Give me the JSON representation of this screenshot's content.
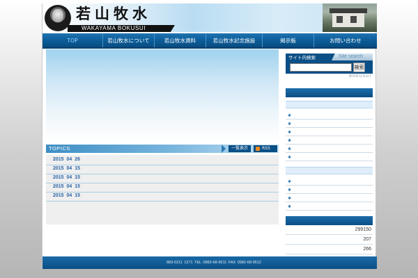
{
  "header": {
    "logo_kanji": "若山牧水",
    "logo_roman": "WAKAYAMA BOKUSUI"
  },
  "nav": {
    "items": [
      {
        "label": "TOP"
      },
      {
        "label": "若山牧水について"
      },
      {
        "label": "若山牧水資料"
      },
      {
        "label": "若山牧水記念施設"
      },
      {
        "label": "掲示板"
      },
      {
        "label": "お問い合わせ"
      }
    ]
  },
  "topics": {
    "title": "TOPICS",
    "list_button": "一覧表示",
    "rss_button": "RSS",
    "rows": [
      {
        "date": "2015 04 26"
      },
      {
        "date": "2015 04 15"
      },
      {
        "date": "2015 04 15"
      },
      {
        "date": "2015 04 15"
      },
      {
        "date": "2015 04 15"
      }
    ]
  },
  "search": {
    "label": "サイト内検索",
    "tab_label": "Site search",
    "input_value": "",
    "button_label": "検索",
    "footer_label": "BOKUSUI"
  },
  "sidebar": {
    "bullet_icon": "asterisk-icon",
    "bullet_glyph": "✱",
    "counter": {
      "total": "299150",
      "today": "207",
      "yesterday": "266"
    }
  },
  "footer": {
    "text": "883-0211      1271   TEL 0982-68-9511  FAX 0982-68-9512"
  },
  "colors": {
    "primary_blue": "#0a4f86",
    "nav_active": "#9fd3ff",
    "topic_date": "#2a64a6"
  }
}
